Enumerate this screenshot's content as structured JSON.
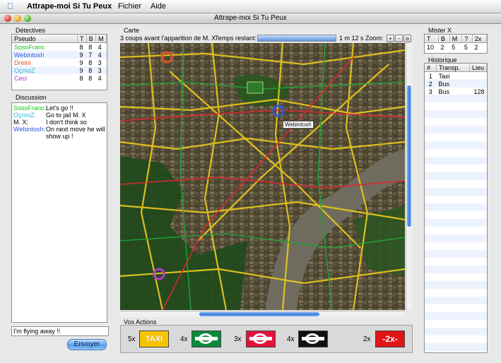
{
  "menubar": {
    "app_name": "Attrape-moi Si Tu Peux",
    "menus": [
      "Fichier",
      "Aide"
    ]
  },
  "window": {
    "title": "Attrape-moi Si Tu Peux"
  },
  "detectives": {
    "label": "Détectives",
    "columns": [
      "Pseudo",
      "T",
      "B",
      "M"
    ],
    "rows": [
      {
        "name": "SosoFranc",
        "t": "8",
        "b": "8",
        "m": "4",
        "color": "#19c21f"
      },
      {
        "name": "Webintosh",
        "t": "9",
        "b": "7",
        "m": "4",
        "color": "#2b58d8"
      },
      {
        "name": "Dreini",
        "t": "9",
        "b": "8",
        "m": "3",
        "color": "#e0502a"
      },
      {
        "name": "OçmoZ",
        "t": "9",
        "b": "8",
        "m": "3",
        "color": "#27b6d6"
      },
      {
        "name": "Ceci",
        "t": "8",
        "b": "8",
        "m": "4",
        "color": "#b836c8"
      }
    ]
  },
  "discussion": {
    "label": "Discussion",
    "messages": [
      {
        "who": "SosoFranc:",
        "text": "Let's go !!",
        "color": "#19c21f"
      },
      {
        "who": "OçmoZ:",
        "text": "Go to jail M. X",
        "color": "#27b6d6"
      },
      {
        "who": "M. X:",
        "text": "I don't think so",
        "color": "#000000"
      },
      {
        "who": "Webintosh:",
        "text": "On next move he will show up !",
        "color": "#2b58d8"
      }
    ],
    "input_value": "I'm flying away !!",
    "send_label": "Envoyer"
  },
  "carte": {
    "label": "Carte",
    "status": "3 coups avant l'apparition de M. X",
    "time_label": "Temps restant:",
    "time_value": "1 m 12 s",
    "zoom_label": "Zoom:",
    "zoom_buttons": [
      "+",
      "-",
      "o"
    ],
    "tooltip": "Webintosh"
  },
  "actions": {
    "label": "Vos Actions",
    "items": [
      {
        "count": "5x",
        "kind": "taxi",
        "text": "TAXI"
      },
      {
        "count": "4x",
        "kind": "bus",
        "text": ""
      },
      {
        "count": "3x",
        "kind": "underground",
        "text": ""
      },
      {
        "count": "4x",
        "kind": "black",
        "text": ""
      },
      {
        "count": "2x",
        "kind": "double",
        "text": "-2x-"
      }
    ]
  },
  "misterx": {
    "label": "Mister X",
    "columns": [
      "T",
      "B",
      "M",
      "?",
      "2x"
    ],
    "values": [
      "10",
      "2",
      "5",
      "5",
      "2"
    ]
  },
  "historique": {
    "label": "Historique",
    "columns": [
      "#",
      "Transp.",
      "Lieu"
    ],
    "rows": [
      {
        "n": "1",
        "transport": "Taxi",
        "lieu": ""
      },
      {
        "n": "2",
        "transport": "Bus",
        "lieu": ""
      },
      {
        "n": "3",
        "transport": "Bus",
        "lieu": "128"
      }
    ]
  },
  "colors": {
    "taxi": "#f5c400",
    "bus": "#0a8a3a",
    "underground": "#e3123c",
    "black": "#111111",
    "double": "#e01515",
    "accent": "#3a7fda"
  }
}
